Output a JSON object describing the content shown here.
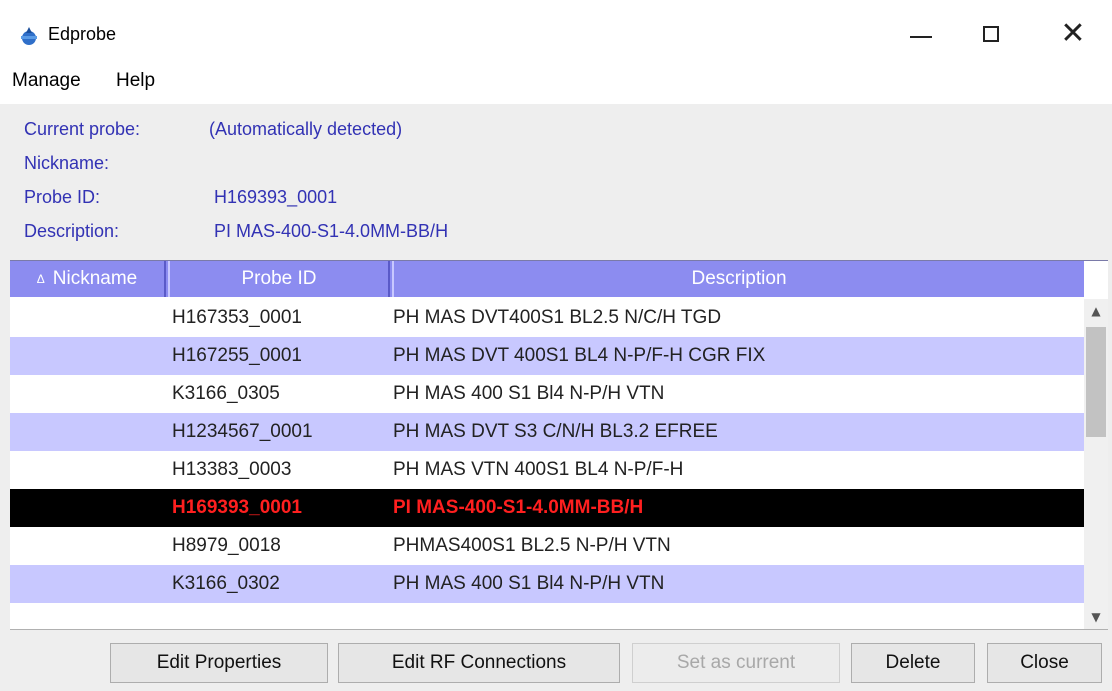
{
  "window": {
    "title": "Edprobe",
    "icon": "edprobe-app-icon"
  },
  "menu": {
    "items": [
      "Manage",
      "Help"
    ]
  },
  "info": {
    "current_probe_label": "Current probe:",
    "current_probe_value": "(Automatically detected)",
    "nickname_label": "Nickname:",
    "nickname_value": "",
    "probe_id_label": "Probe ID:",
    "probe_id_value": "H169393_0001",
    "description_label": "Description:",
    "description_value": "PI MAS-400-S1-4.0MM-BB/H"
  },
  "table": {
    "sort_indicator": "Δ",
    "columns": [
      "Nickname",
      "Probe ID",
      "Description"
    ],
    "rows": [
      {
        "nickname": "",
        "probe_id": "H167353_0001",
        "description": "PH MAS DVT400S1 BL2.5 N/C/H TGD"
      },
      {
        "nickname": "",
        "probe_id": "H167255_0001",
        "description": "PH MAS DVT 400S1 BL4 N-P/F-H CGR FIX"
      },
      {
        "nickname": "",
        "probe_id": "K3166_0305",
        "description": "PH MAS 400 S1 Bl4 N-P/H VTN"
      },
      {
        "nickname": "",
        "probe_id": "H1234567_0001",
        "description": "PH MAS DVT S3 C/N/H BL3.2 EFREE"
      },
      {
        "nickname": "",
        "probe_id": "H13383_0003",
        "description": "PH MAS VTN 400S1 BL4 N-P/F-H"
      },
      {
        "nickname": "",
        "probe_id": "H169393_0001",
        "description": "PI MAS-400-S1-4.0MM-BB/H",
        "selected": true
      },
      {
        "nickname": "",
        "probe_id": "H8979_0018",
        "description": "PHMAS400S1 BL2.5 N-P/H VTN"
      },
      {
        "nickname": "",
        "probe_id": "K3166_0302",
        "description": "PH MAS 400 S1 Bl4 N-P/H VTN"
      }
    ]
  },
  "buttons": {
    "edit_properties": "Edit Properties",
    "edit_rf": "Edit RF Connections",
    "set_current": "Set as current",
    "delete": "Delete",
    "close": "Close"
  },
  "colors": {
    "header_bg": "#8c8cf0",
    "alt_row_bg": "#c8c8ff",
    "info_text": "#3232b4",
    "selected_bg": "#000000",
    "selected_text": "#ff1f1f"
  }
}
